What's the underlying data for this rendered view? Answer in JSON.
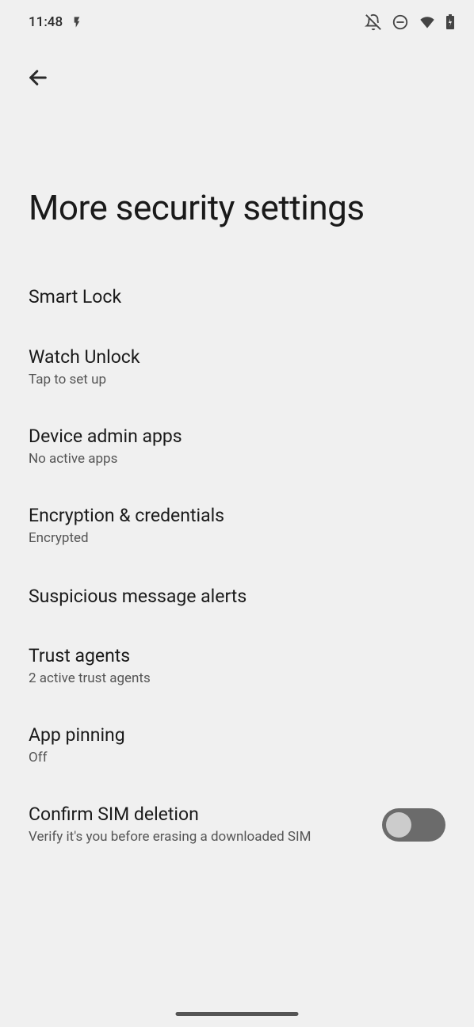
{
  "status_bar": {
    "time": "11:48"
  },
  "page": {
    "title": "More security settings"
  },
  "settings": [
    {
      "label": "Smart Lock",
      "sublabel": null,
      "has_toggle": false
    },
    {
      "label": "Watch Unlock",
      "sublabel": "Tap to set up",
      "has_toggle": false
    },
    {
      "label": "Device admin apps",
      "sublabel": "No active apps",
      "has_toggle": false
    },
    {
      "label": "Encryption & credentials",
      "sublabel": "Encrypted",
      "has_toggle": false
    },
    {
      "label": "Suspicious message alerts",
      "sublabel": null,
      "has_toggle": false
    },
    {
      "label": "Trust agents",
      "sublabel": "2 active trust agents",
      "has_toggle": false
    },
    {
      "label": "App pinning",
      "sublabel": "Off",
      "has_toggle": false
    },
    {
      "label": "Confirm SIM deletion",
      "sublabel": "Verify it's you before erasing a downloaded SIM",
      "has_toggle": true,
      "toggle_state": false
    }
  ]
}
